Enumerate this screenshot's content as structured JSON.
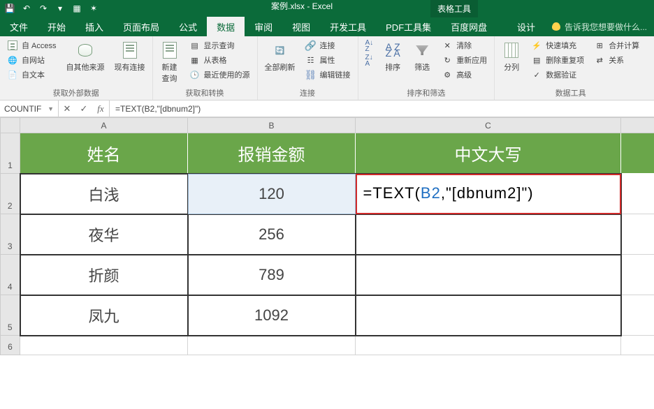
{
  "titlebar": {
    "doc_title": "案例.xlsx - Excel",
    "context_tab": "表格工具"
  },
  "qat": {
    "save": "💾",
    "undo": "↶",
    "redo": "↷"
  },
  "tabs": {
    "file": "文件",
    "home": "开始",
    "insert": "插入",
    "layout": "页面布局",
    "formulas": "公式",
    "data": "数据",
    "review": "审阅",
    "view": "视图",
    "dev": "开发工具",
    "pdf": "PDF工具集",
    "baidu": "百度网盘",
    "design": "设计",
    "tell_me": "告诉我您想要做什么..."
  },
  "ribbon": {
    "ext_data": {
      "access": "自 Access",
      "web": "自网站",
      "text": "自文本",
      "other": "自其他来源",
      "existing": "现有连接",
      "label": "获取外部数据"
    },
    "get_transform": {
      "new_query": "新建\n查询",
      "show_queries": "显示查询",
      "from_table": "从表格",
      "recent": "最近使用的源",
      "label": "获取和转换"
    },
    "connections": {
      "refresh": "全部刷新",
      "conn": "连接",
      "props": "属性",
      "edit_links": "编辑链接",
      "label": "连接"
    },
    "sort_filter": {
      "sort": "排序",
      "filter": "筛选",
      "clear": "清除",
      "reapply": "重新应用",
      "advanced": "高级",
      "label": "排序和筛选"
    },
    "data_tools": {
      "text_to_cols": "分列",
      "flash_fill": "快速填充",
      "remove_dup": "删除重复项",
      "data_valid": "数据验证",
      "consolidate": "合并计算",
      "relations": "关系",
      "label": "数据工具"
    }
  },
  "formula_bar": {
    "name_box": "COUNTIF",
    "formula": "=TEXT(B2,\"[dbnum2]\")"
  },
  "columns": {
    "a": "A",
    "b": "B",
    "c": "C"
  },
  "rows": {
    "r1": "1",
    "r2": "2",
    "r3": "3",
    "r4": "4",
    "r5": "5",
    "r6": "6"
  },
  "table": {
    "headers": {
      "name": "姓名",
      "amount": "报销金额",
      "chinese": "中文大写"
    },
    "data": [
      {
        "name": "白浅",
        "amount": "120"
      },
      {
        "name": "夜华",
        "amount": "256"
      },
      {
        "name": "折颜",
        "amount": "789"
      },
      {
        "name": "凤九",
        "amount": "1092"
      }
    ],
    "editing": {
      "prefix": "=TEXT(",
      "ref": "B2",
      "suffix": ",\"[dbnum2]\")"
    }
  }
}
